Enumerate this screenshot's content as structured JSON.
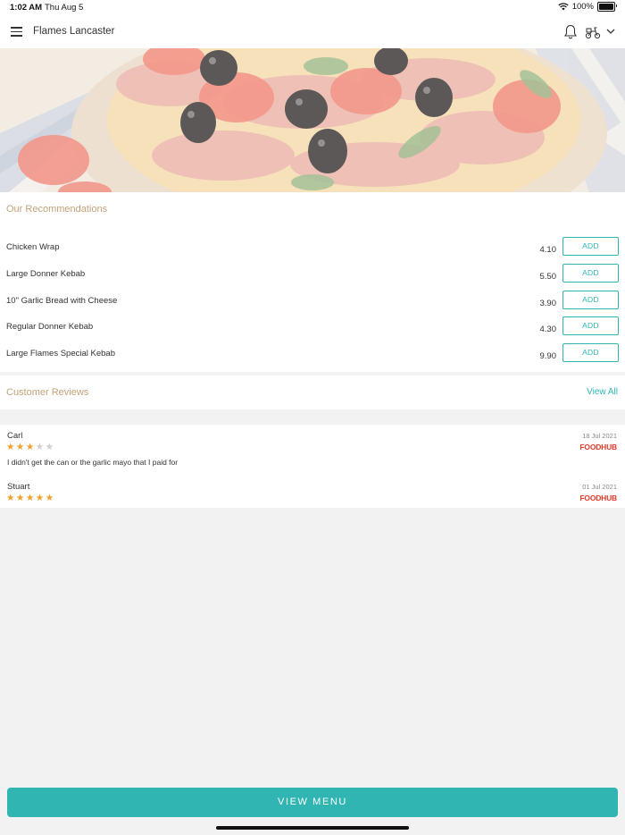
{
  "status_bar": {
    "time": "1:02 AM",
    "date": "Thu Aug 5",
    "battery": "100%"
  },
  "header": {
    "title": "Flames Lancaster",
    "icons": [
      "menu-icon",
      "bell-icon",
      "scooter-icon",
      "chevron-down-icon"
    ]
  },
  "recommendations": {
    "title": "Our Recommendations",
    "items": [
      {
        "name": "Chicken Wrap",
        "price": "4.10",
        "button": "ADD"
      },
      {
        "name": "Large Donner Kebab",
        "price": "5.50",
        "button": "ADD"
      },
      {
        "name": "10\" Garlic Bread with Cheese",
        "price": "3.90",
        "button": "ADD"
      },
      {
        "name": "Regular Donner Kebab",
        "price": "4.30",
        "button": "ADD"
      },
      {
        "name": "Large Flames Special Kebab",
        "price": "9.90",
        "button": "ADD"
      }
    ]
  },
  "reviews": {
    "title": "Customer Reviews",
    "view_all": "View All",
    "items": [
      {
        "author": "Carl",
        "rating": 3,
        "max": 5,
        "date": "18 Jul 2021",
        "source": "FOODHUB",
        "text": "I didn't get the can or the garlic mayo that I paid for"
      },
      {
        "author": "Stuart",
        "rating": 5,
        "max": 5,
        "date": "01 Jul 2021",
        "source": "FOODHUB",
        "text": ""
      }
    ]
  },
  "footer": {
    "view_menu": "VIEW MENU"
  },
  "colors": {
    "accent": "#31b5b3",
    "section_title": "#c3a27a",
    "star": "#f0a02a",
    "brand": "#e03a2a"
  }
}
